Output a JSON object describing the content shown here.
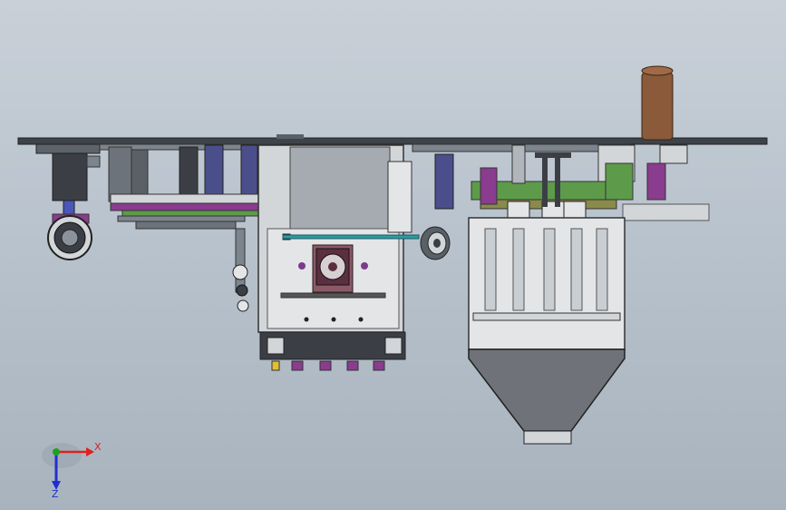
{
  "viewport": {
    "background_top": "#c9d0d8",
    "background_bottom": "#a8b3be"
  },
  "model": {
    "colors": {
      "plate": "#3e4349",
      "frame": "#7c858e",
      "light_metal": "#d3d6d9",
      "hopper": "#6f7379",
      "motor": "#3b3f45",
      "purple": "#8a3c8e",
      "green": "#5d9b4a",
      "copper": "#8a5a3a",
      "teal": "#2f9aa3"
    }
  },
  "triad": {
    "x_label": "X",
    "z_label": "Z",
    "x_color": "#e02020",
    "z_color": "#2030d0",
    "y_color": "#20a020"
  }
}
